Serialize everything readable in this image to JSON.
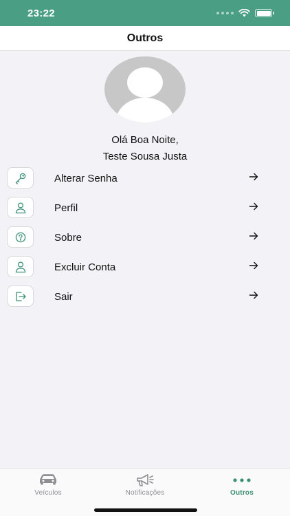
{
  "status_bar": {
    "time": "23:22"
  },
  "header": {
    "title": "Outros"
  },
  "greeting": {
    "line1": "Olá Boa Noite,",
    "line2": "Teste Sousa Justa"
  },
  "menu": {
    "items": [
      {
        "label": "Alterar Senha",
        "icon": "key-icon"
      },
      {
        "label": "Perfil",
        "icon": "user-icon"
      },
      {
        "label": "Sobre",
        "icon": "question-circle-icon"
      },
      {
        "label": "Excluir Conta",
        "icon": "user-icon"
      },
      {
        "label": "Sair",
        "icon": "logout-icon"
      }
    ]
  },
  "tab_bar": {
    "tabs": [
      {
        "label": "Veículos",
        "icon": "car-icon",
        "active": false
      },
      {
        "label": "Notificações",
        "icon": "megaphone-icon",
        "active": false
      },
      {
        "label": "Outros",
        "icon": "more-dots-icon",
        "active": true
      }
    ]
  },
  "colors": {
    "primary": "#4a9e83",
    "accent": "#3b8f74",
    "inactive": "#8e8e93",
    "background": "#f2f2f7"
  }
}
